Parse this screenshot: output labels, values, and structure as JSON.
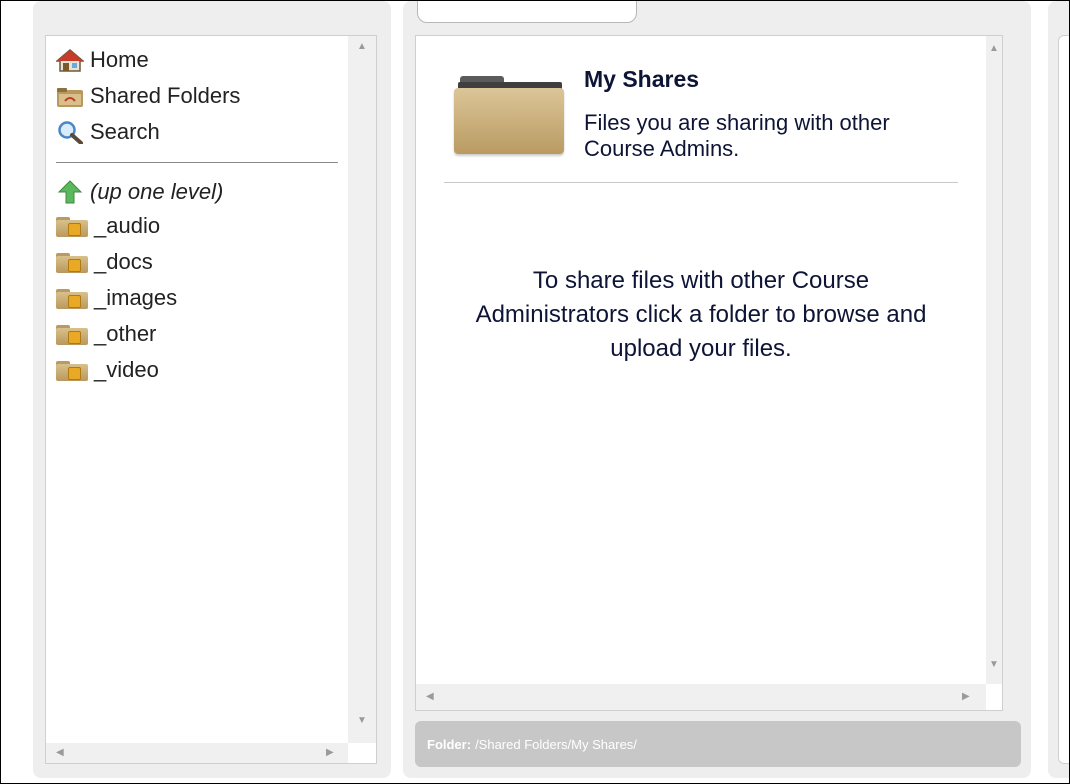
{
  "nav": {
    "items": [
      {
        "label": "Home",
        "icon": "home-icon"
      },
      {
        "label": "Shared Folders",
        "icon": "shared-folders-icon"
      },
      {
        "label": "Search",
        "icon": "search-icon"
      }
    ]
  },
  "tree": {
    "up_label": "(up one level)",
    "folders": [
      "_audio",
      "_docs",
      "_images",
      "_other",
      "_video"
    ]
  },
  "main": {
    "title": "My Shares",
    "subtitle": "Files you are sharing with other Course Admins.",
    "message": "To share files with other Course Administrators click a folder to browse and upload your files."
  },
  "status": {
    "label": "Folder:",
    "path": "/Shared Folders/My Shares/"
  },
  "colors": {
    "title": "#0d1436",
    "panel_bg": "#eeeeee",
    "status_bar": "#c7c7c7"
  }
}
